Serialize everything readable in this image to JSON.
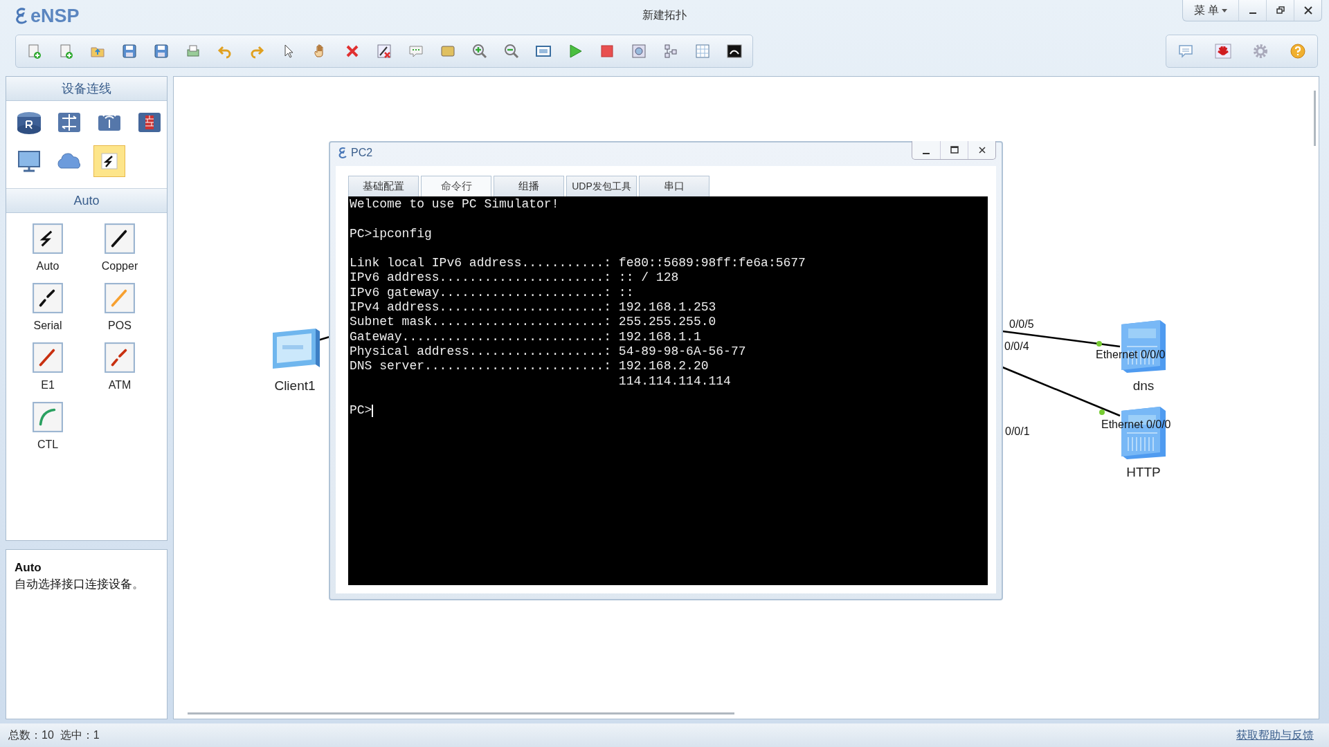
{
  "app": {
    "logo": "eNSP",
    "title": "新建拓扑",
    "menu_button": "菜 单"
  },
  "device_panel": {
    "title": "设备连线",
    "devices": [
      {
        "kind": "router",
        "selected": false
      },
      {
        "kind": "switch",
        "selected": false
      },
      {
        "kind": "wireless",
        "selected": false
      },
      {
        "kind": "firewall",
        "selected": false
      },
      {
        "kind": "terminal",
        "selected": false
      },
      {
        "kind": "cloud",
        "selected": false
      },
      {
        "kind": "cable",
        "selected": true
      }
    ]
  },
  "cable_panel": {
    "title": "Auto",
    "cables": [
      {
        "kind": "auto",
        "label": "Auto"
      },
      {
        "kind": "copper",
        "label": "Copper"
      },
      {
        "kind": "serial",
        "label": "Serial"
      },
      {
        "kind": "pos",
        "label": "POS"
      },
      {
        "kind": "e1",
        "label": "E1"
      },
      {
        "kind": "atm",
        "label": "ATM"
      },
      {
        "kind": "ctl",
        "label": "CTL"
      }
    ]
  },
  "description": {
    "title": "Auto",
    "text": "自动选择接口连接设备。"
  },
  "topology": {
    "nodes": [
      {
        "kind": "client",
        "label": "Client1"
      },
      {
        "kind": "server",
        "label": "dns"
      },
      {
        "kind": "server",
        "label": "HTTP"
      }
    ],
    "port_labels": [
      "0/0/5",
      "0/0/4",
      "0/0/1",
      "Ethernet 0/0/0",
      "Ethernet 0/0/0"
    ]
  },
  "pc_window": {
    "title": "PC2",
    "tabs": [
      {
        "label": "基础配置",
        "selected": false
      },
      {
        "label": "命令行",
        "selected": true
      },
      {
        "label": "组播",
        "selected": false
      },
      {
        "label": "UDP发包工具",
        "selected": false
      },
      {
        "label": "串口",
        "selected": false
      }
    ],
    "terminal_blocks": [
      [
        "Welcome to use PC Simulator!"
      ],
      [
        "PC>ipconfig"
      ],
      [
        "Link local IPv6 address...........: fe80::5689:98ff:fe6a:5677",
        "IPv6 address......................: :: / 128",
        "IPv6 gateway......................: ::",
        "IPv4 address......................: 192.168.1.253",
        "Subnet mask.......................: 255.255.255.0",
        "Gateway...........................: 192.168.1.1",
        "Physical address..................: 54-89-98-6A-56-77",
        "DNS server........................: 192.168.2.20",
        "                                    114.114.114.114"
      ],
      [
        "PC>"
      ]
    ]
  },
  "status_bar": {
    "summary": "总数：10  选中：1",
    "help_link": "获取帮助与反馈"
  }
}
